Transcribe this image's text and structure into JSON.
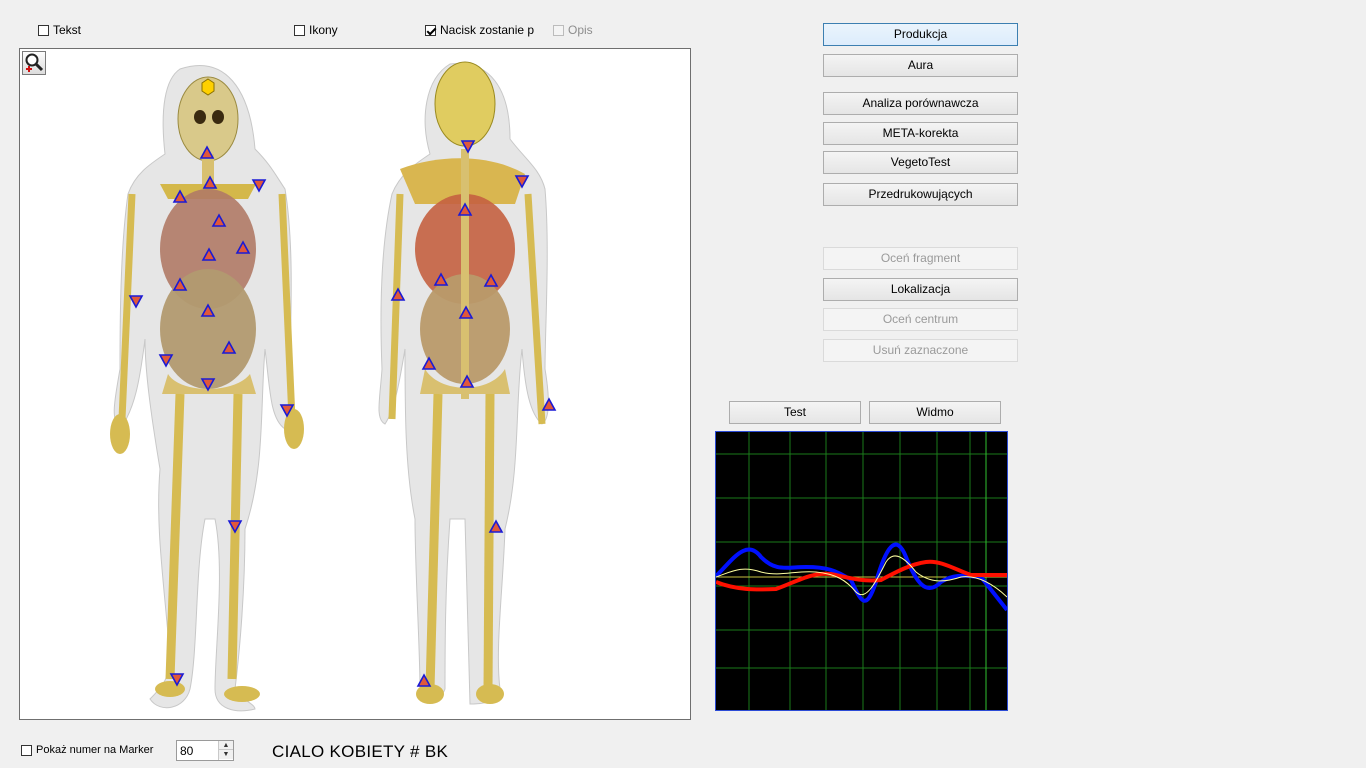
{
  "toolbar": {
    "tekst": {
      "label": "Tekst",
      "checked": false
    },
    "ikony": {
      "label": "Ikony",
      "checked": false
    },
    "nacisk": {
      "label": "Nacisk zostanie p",
      "checked": true
    },
    "opis": {
      "label": "Opis",
      "checked": false,
      "disabled": true
    }
  },
  "buttons": {
    "produkcja": "Produkcja",
    "aura": "Aura",
    "analiza": "Analiza porównawcza",
    "meta": "META-korekta",
    "vegeto": "VegetoTest",
    "przedruk": "Przedrukowujących",
    "ocen_fragment": "Oceń fragment",
    "lokalizacja": "Lokalizacja",
    "ocen_centrum": "Oceń centrum",
    "usun": "Usuń zaznaczone",
    "test": "Test",
    "widmo": "Widmo"
  },
  "footer": {
    "marker_label": "Pokaż numer na Marker",
    "marker_checked": false,
    "spin_value": "80",
    "caption": "CIALO KOBIETY # BK"
  },
  "icons": {
    "zoom": "magnifier-plus-icon",
    "spin_up": "arrow-up-icon",
    "spin_down": "arrow-down-icon"
  },
  "colors": {
    "marker_fill": "#e0583a",
    "marker_border": "#1a1ad6",
    "wave_blue": "#0010ff",
    "wave_red": "#ff1000",
    "wave_yellow": "#ffffa0",
    "grid": "#1a7a1a"
  }
}
